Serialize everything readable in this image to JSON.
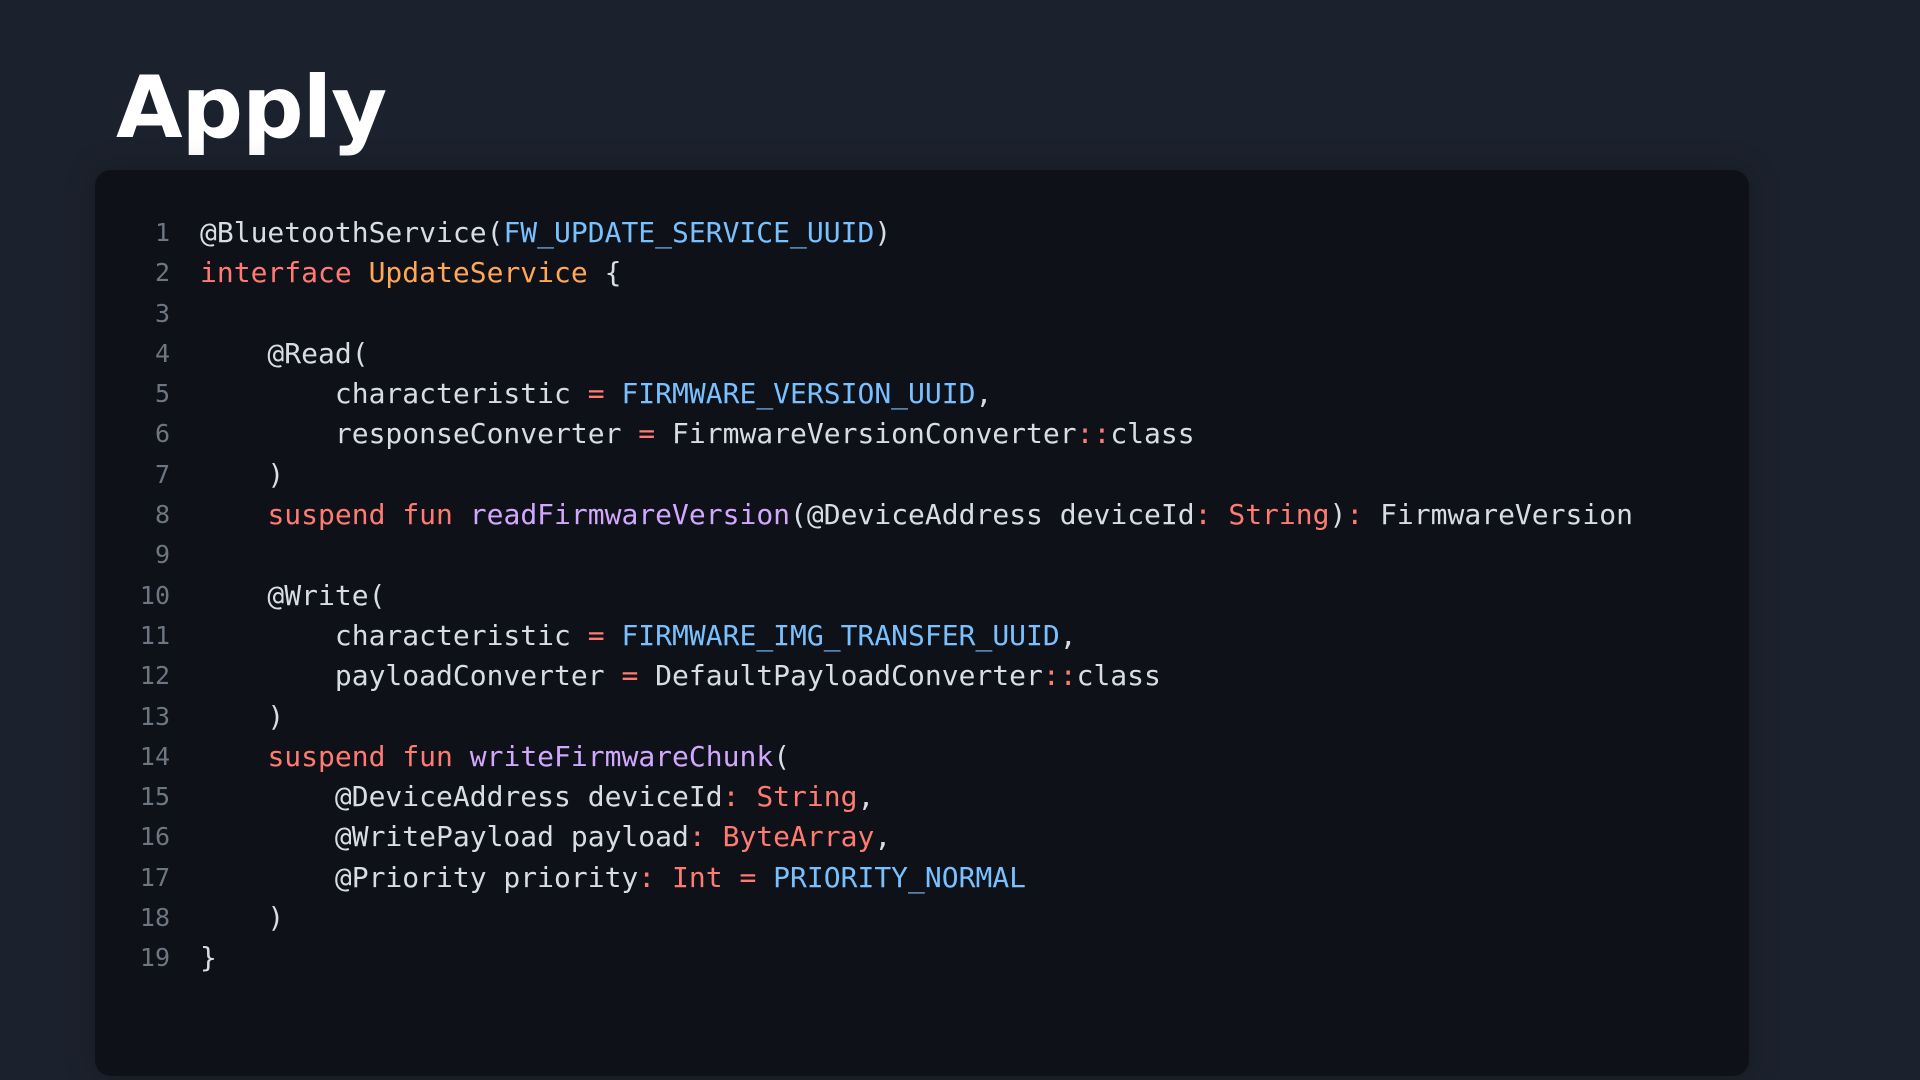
{
  "slide": {
    "title": "Apply"
  },
  "colors": {
    "background": "#1c222d",
    "code_background": "#0e1118",
    "line_number": "#6e7681",
    "plain": "#d8dde5",
    "keyword": "#ff7b72",
    "type": "#ffa657",
    "constant": "#79c0ff",
    "function": "#d2a8ff"
  },
  "code": {
    "language": "kotlin",
    "lines": [
      {
        "n": "1",
        "tokens": [
          {
            "t": "@BluetoothService(",
            "k": "plain"
          },
          {
            "t": "FW_UPDATE_SERVICE_UUID",
            "k": "const"
          },
          {
            "t": ")",
            "k": "plain"
          }
        ]
      },
      {
        "n": "2",
        "tokens": [
          {
            "t": "interface",
            "k": "kw"
          },
          {
            "t": " ",
            "k": "plain"
          },
          {
            "t": "UpdateService",
            "k": "type"
          },
          {
            "t": " {",
            "k": "plain"
          }
        ]
      },
      {
        "n": "3",
        "tokens": []
      },
      {
        "n": "4",
        "tokens": [
          {
            "t": "    @Read(",
            "k": "plain"
          }
        ]
      },
      {
        "n": "5",
        "tokens": [
          {
            "t": "        characteristic ",
            "k": "plain"
          },
          {
            "t": "=",
            "k": "op"
          },
          {
            "t": " ",
            "k": "plain"
          },
          {
            "t": "FIRMWARE_VERSION_UUID",
            "k": "const"
          },
          {
            "t": ",",
            "k": "plain"
          }
        ]
      },
      {
        "n": "6",
        "tokens": [
          {
            "t": "        responseConverter ",
            "k": "plain"
          },
          {
            "t": "=",
            "k": "op"
          },
          {
            "t": " FirmwareVersionConverter",
            "k": "plain"
          },
          {
            "t": "::",
            "k": "op"
          },
          {
            "t": "class",
            "k": "plain"
          }
        ]
      },
      {
        "n": "7",
        "tokens": [
          {
            "t": "    )",
            "k": "plain"
          }
        ]
      },
      {
        "n": "8",
        "tokens": [
          {
            "t": "    ",
            "k": "plain"
          },
          {
            "t": "suspend",
            "k": "kw"
          },
          {
            "t": " ",
            "k": "plain"
          },
          {
            "t": "fun",
            "k": "kw"
          },
          {
            "t": " ",
            "k": "plain"
          },
          {
            "t": "readFirmwareVersion",
            "k": "fn"
          },
          {
            "t": "(@DeviceAddress deviceId",
            "k": "plain"
          },
          {
            "t": ":",
            "k": "op"
          },
          {
            "t": " ",
            "k": "plain"
          },
          {
            "t": "String",
            "k": "builtin"
          },
          {
            "t": ")",
            "k": "plain"
          },
          {
            "t": ":",
            "k": "op"
          },
          {
            "t": " FirmwareVersion",
            "k": "plain"
          }
        ]
      },
      {
        "n": "9",
        "tokens": []
      },
      {
        "n": "10",
        "tokens": [
          {
            "t": "    @Write(",
            "k": "plain"
          }
        ]
      },
      {
        "n": "11",
        "tokens": [
          {
            "t": "        characteristic ",
            "k": "plain"
          },
          {
            "t": "=",
            "k": "op"
          },
          {
            "t": " ",
            "k": "plain"
          },
          {
            "t": "FIRMWARE_IMG_TRANSFER_UUID",
            "k": "const"
          },
          {
            "t": ",",
            "k": "plain"
          }
        ]
      },
      {
        "n": "12",
        "tokens": [
          {
            "t": "        payloadConverter ",
            "k": "plain"
          },
          {
            "t": "=",
            "k": "op"
          },
          {
            "t": " DefaultPayloadConverter",
            "k": "plain"
          },
          {
            "t": "::",
            "k": "op"
          },
          {
            "t": "class",
            "k": "plain"
          }
        ]
      },
      {
        "n": "13",
        "tokens": [
          {
            "t": "    )",
            "k": "plain"
          }
        ]
      },
      {
        "n": "14",
        "tokens": [
          {
            "t": "    ",
            "k": "plain"
          },
          {
            "t": "suspend",
            "k": "kw"
          },
          {
            "t": " ",
            "k": "plain"
          },
          {
            "t": "fun",
            "k": "kw"
          },
          {
            "t": " ",
            "k": "plain"
          },
          {
            "t": "writeFirmwareChunk",
            "k": "fn"
          },
          {
            "t": "(",
            "k": "plain"
          }
        ]
      },
      {
        "n": "15",
        "tokens": [
          {
            "t": "        @DeviceAddress deviceId",
            "k": "plain"
          },
          {
            "t": ":",
            "k": "op"
          },
          {
            "t": " ",
            "k": "plain"
          },
          {
            "t": "String",
            "k": "builtin"
          },
          {
            "t": ",",
            "k": "plain"
          }
        ]
      },
      {
        "n": "16",
        "tokens": [
          {
            "t": "        @WritePayload payload",
            "k": "plain"
          },
          {
            "t": ":",
            "k": "op"
          },
          {
            "t": " ",
            "k": "plain"
          },
          {
            "t": "ByteArray",
            "k": "builtin"
          },
          {
            "t": ",",
            "k": "plain"
          }
        ]
      },
      {
        "n": "17",
        "tokens": [
          {
            "t": "        @Priority priority",
            "k": "plain"
          },
          {
            "t": ":",
            "k": "op"
          },
          {
            "t": " ",
            "k": "plain"
          },
          {
            "t": "Int",
            "k": "builtin"
          },
          {
            "t": " ",
            "k": "plain"
          },
          {
            "t": "=",
            "k": "op"
          },
          {
            "t": " ",
            "k": "plain"
          },
          {
            "t": "PRIORITY_NORMAL",
            "k": "const"
          }
        ]
      },
      {
        "n": "18",
        "tokens": [
          {
            "t": "    )",
            "k": "plain"
          }
        ]
      },
      {
        "n": "19",
        "tokens": [
          {
            "t": "}",
            "k": "plain"
          }
        ]
      }
    ]
  }
}
